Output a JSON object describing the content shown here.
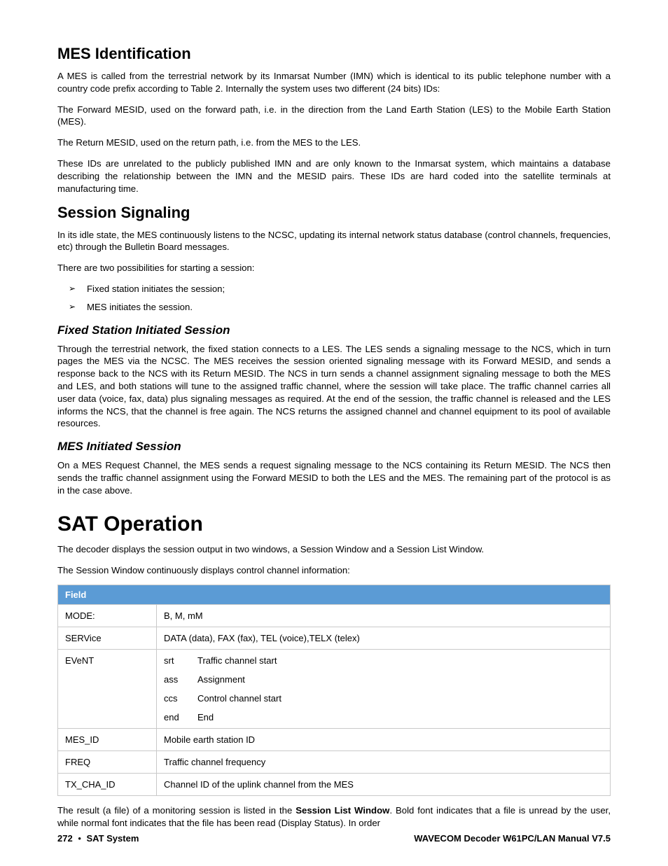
{
  "sections": {
    "mes_id": {
      "heading": "MES Identification",
      "paragraphs": {
        "p1": "A MES is called from the terrestrial network by its Inmarsat Number (IMN) which is identical to its public telephone number with a country code prefix according to Table 2. Internally the system uses two different (24 bits) IDs:",
        "p2": "The Forward MESID, used on the forward path, i.e. in the direction from the Land Earth Station (LES) to the Mobile Earth Station (MES).",
        "p3": "The Return MESID, used on the return path, i.e. from the MES to the LES.",
        "p4": "These IDs are unrelated to the publicly published IMN and are only known to the Inmarsat system, which maintains a database describing the relationship between the IMN and the MESID pairs. These IDs are hard coded into the satellite terminals at manufacturing time."
      }
    },
    "session_sig": {
      "heading": "Session Signaling",
      "paragraphs": {
        "p1": "In its idle state, the MES continuously listens to the NCSC, updating its internal network status database (control channels, frequencies, etc) through the Bulletin Board messages.",
        "p2": "There are two possibilities for starting a session:"
      },
      "bullets": [
        "Fixed station initiates the session;",
        "MES initiates the session."
      ],
      "fixed": {
        "heading": "Fixed Station Initiated Session",
        "p1": "Through the terrestrial network, the fixed station connects to a LES. The LES sends a signaling message to the NCS, which in turn pages the MES via the NCSC. The MES receives the session oriented signaling message with its Forward MESID, and sends a response back to the NCS with its Return MESID. The NCS in turn sends a channel assignment signaling message to both the MES and LES, and both stations will tune to the assigned traffic channel, where the session will take place. The traffic channel carries all user data (voice, fax, data) plus signaling messages as required. At the end of the session, the traffic channel is released and the LES informs the NCS, that the channel is free again. The NCS returns the assigned channel and channel equipment to its pool of available resources."
      },
      "mes_init": {
        "heading": "MES Initiated Session",
        "p1": "On a MES Request Channel, the MES sends a request signaling message to the NCS containing its Return MESID. The NCS then sends the traffic channel assignment using the Forward MESID to both the LES and the MES. The remaining part of the protocol is as in the case above."
      }
    },
    "sat_op": {
      "heading": "SAT Operation",
      "paragraphs": {
        "p1": "The decoder displays the session output in two windows, a Session Window and a Session List Window.",
        "p2": "The Session Window continuously displays control channel information:"
      },
      "result": {
        "pre": "The result (a file) of a monitoring session is listed in the ",
        "bold": "Session List Window",
        "post": ". Bold font indicates that a file is unread by the user, while normal font indicates that the file has been read (Display Status). In order"
      }
    }
  },
  "table": {
    "header": "Field",
    "rows": [
      {
        "field": "MODE:",
        "desc": "B, M, mM"
      },
      {
        "field": "SERVice",
        "desc": "DATA (data), FAX (fax), TEL (voice),TELX (telex)"
      },
      {
        "field": "EVeNT",
        "events": [
          {
            "code": "srt",
            "label": "Traffic channel start"
          },
          {
            "code": "ass",
            "label": "Assignment"
          },
          {
            "code": "ccs",
            "label": "Control channel start"
          },
          {
            "code": "end",
            "label": "End"
          }
        ]
      },
      {
        "field": "MES_ID",
        "desc": "Mobile earth station ID"
      },
      {
        "field": "FREQ",
        "desc": "Traffic channel frequency"
      },
      {
        "field": "TX_CHA_ID",
        "desc": "Channel ID of the uplink channel from the MES"
      }
    ]
  },
  "footer": {
    "page_number": "272",
    "left_section": "SAT System",
    "right": "WAVECOM Decoder W61PC/LAN Manual V7.5"
  }
}
